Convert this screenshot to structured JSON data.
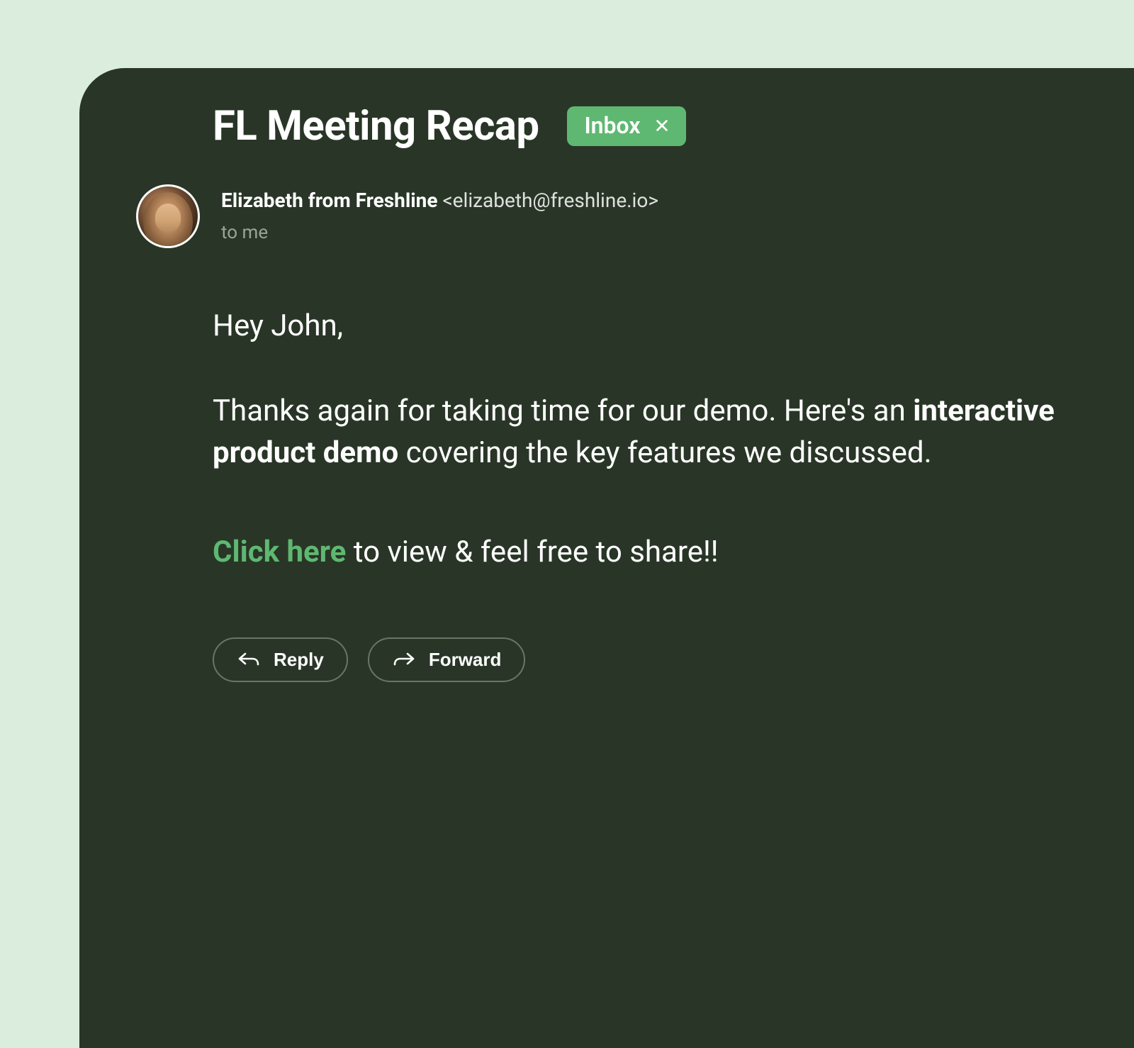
{
  "subject": "FL Meeting Recap",
  "badge": {
    "label": "Inbox"
  },
  "sender": {
    "name": "Elizabeth from Freshline",
    "email": "<elizabeth@freshline.io>"
  },
  "recipient": "to me",
  "body": {
    "greeting": "Hey John,",
    "p1_a": "Thanks again for taking time for our demo. Here's an ",
    "p1_bold": "interactive product demo",
    "p1_b": " covering the key features we discussed.",
    "cta_link": "Click here",
    "cta_rest": " to view & feel free to share!!"
  },
  "actions": {
    "reply": "Reply",
    "forward": "Forward"
  }
}
